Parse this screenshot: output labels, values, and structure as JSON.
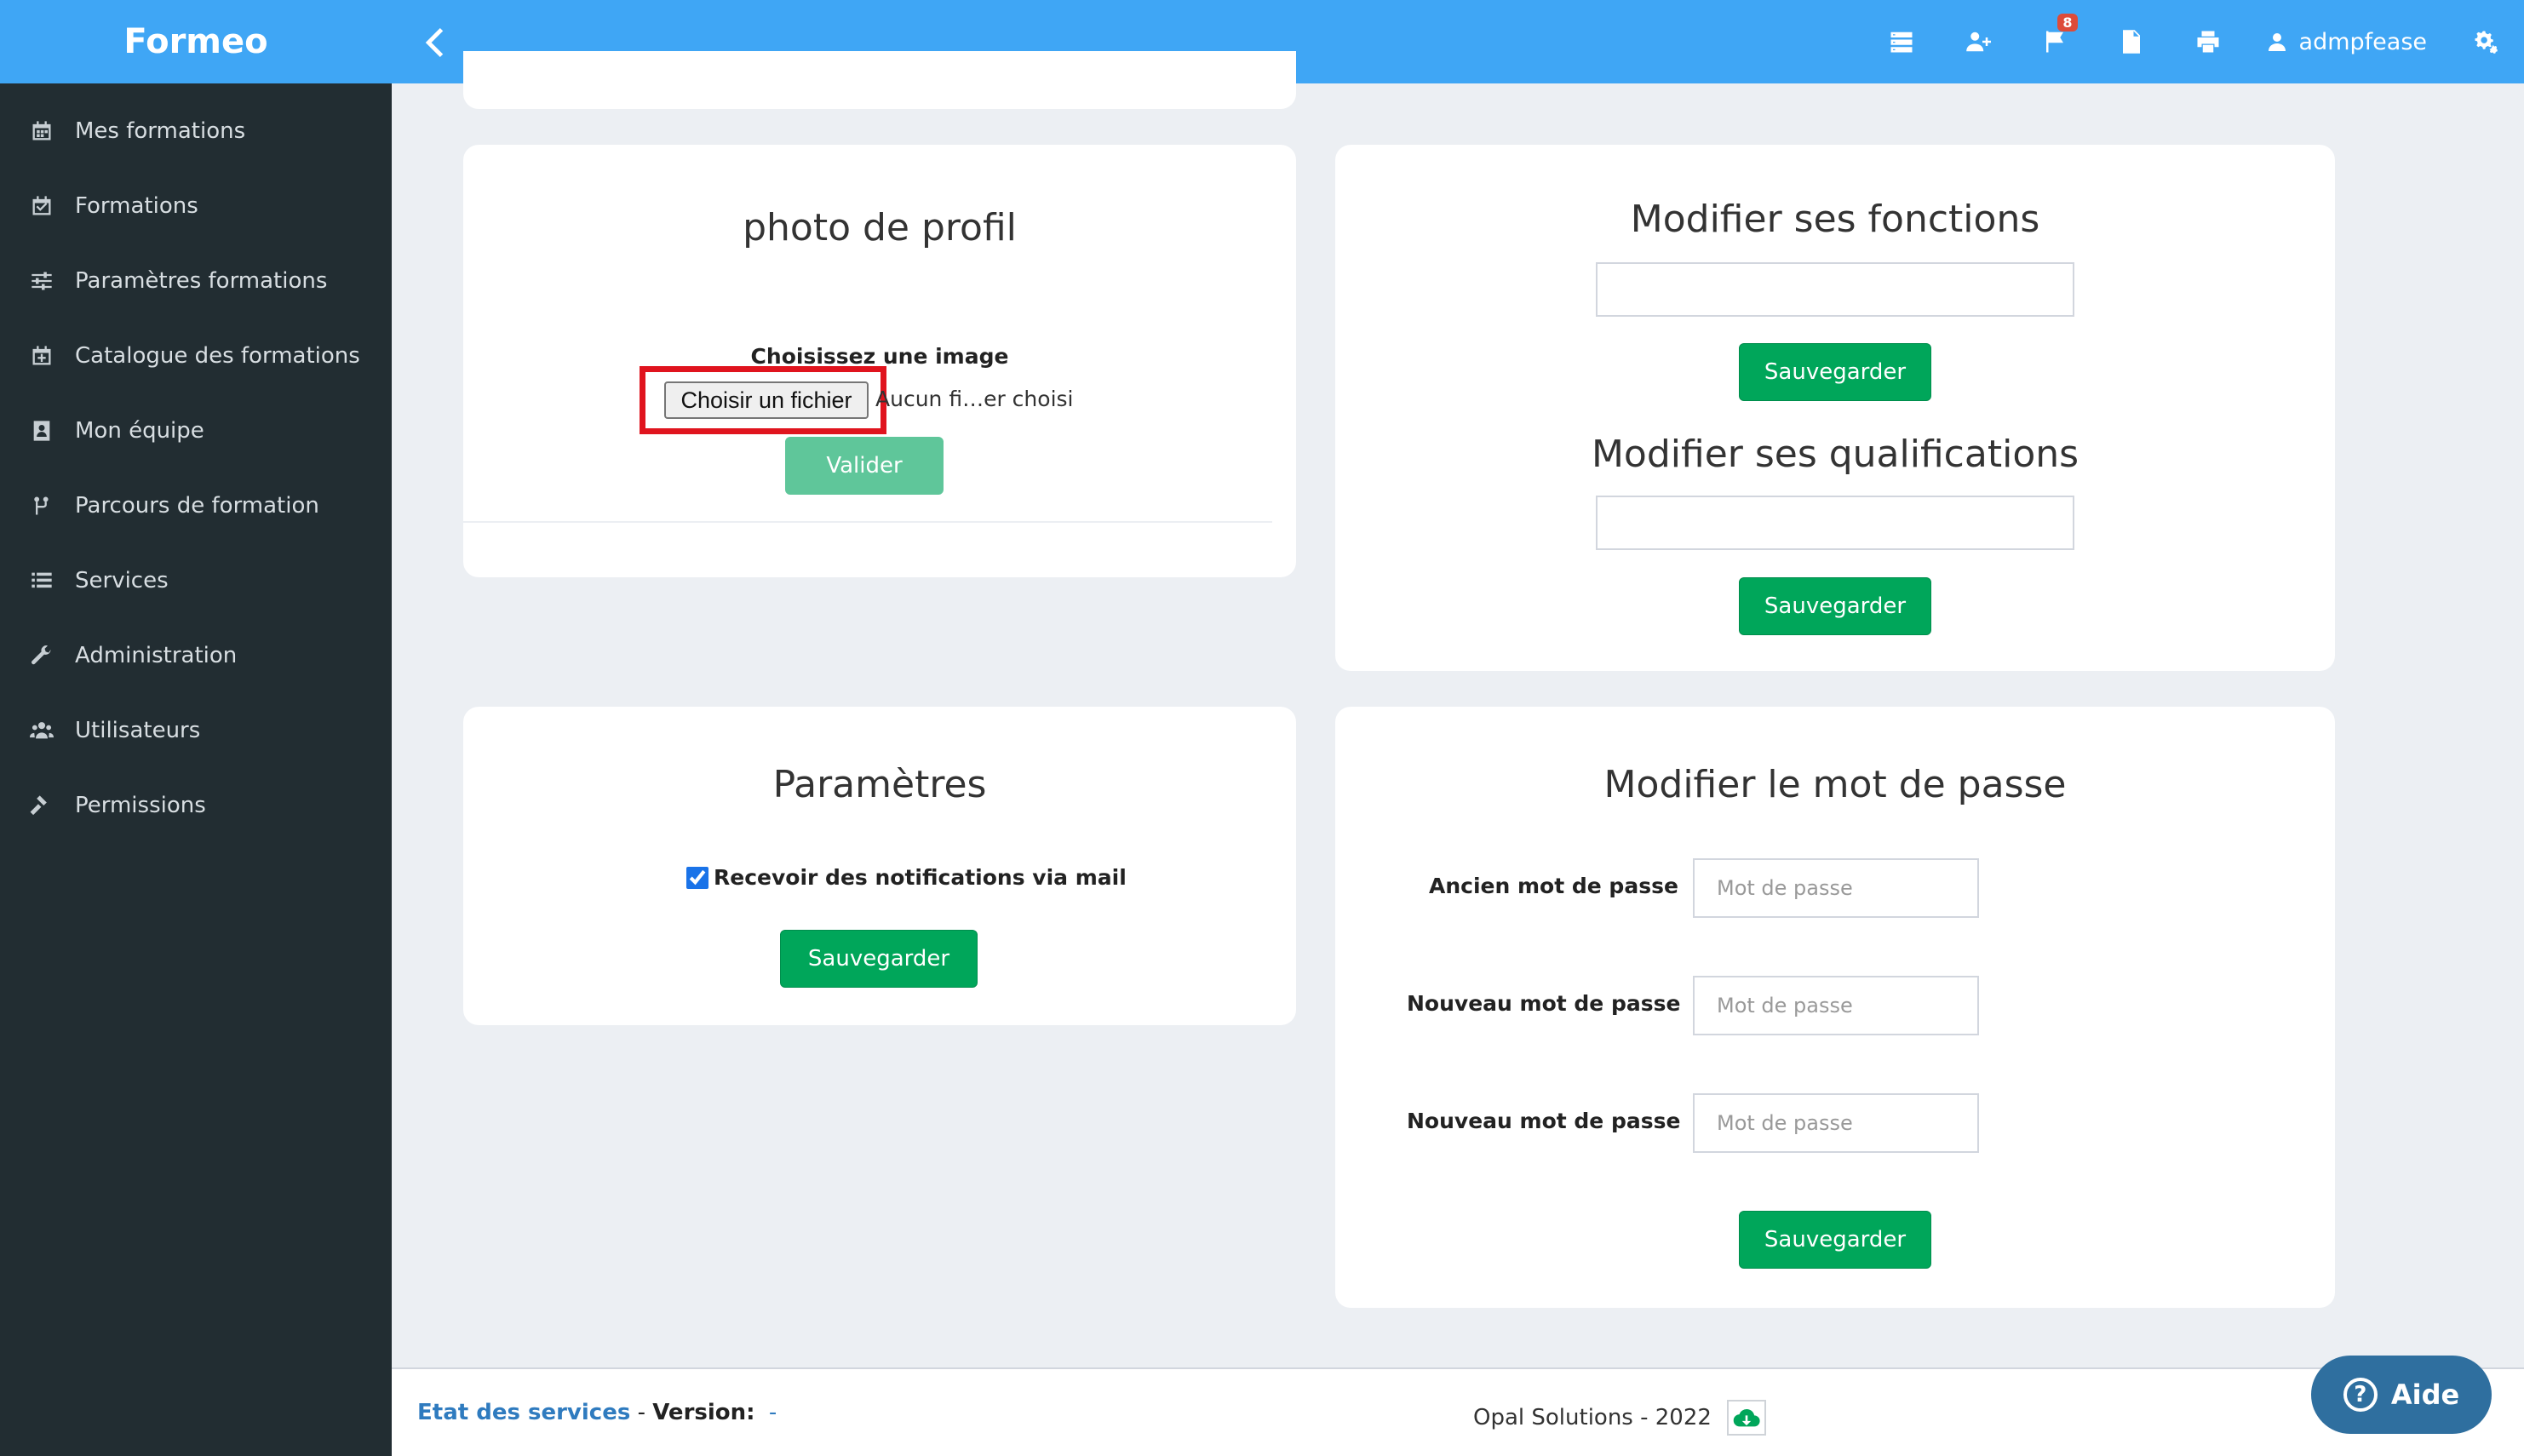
{
  "brand": "Formeo",
  "sidebar": {
    "items": [
      {
        "label": "Mes formations",
        "icon": "calendar-icon"
      },
      {
        "label": "Formations",
        "icon": "calendar-check-icon"
      },
      {
        "label": "Paramètres formations",
        "icon": "sliders-icon"
      },
      {
        "label": "Catalogue des formations",
        "icon": "calendar-plus-icon"
      },
      {
        "label": "Mon équipe",
        "icon": "address-book-icon"
      },
      {
        "label": "Parcours de formation",
        "icon": "code-fork-icon"
      },
      {
        "label": "Services",
        "icon": "list-icon"
      },
      {
        "label": "Administration",
        "icon": "wrench-icon"
      },
      {
        "label": "Utilisateurs",
        "icon": "users-icon"
      },
      {
        "label": "Permissions",
        "icon": "gavel-icon"
      }
    ]
  },
  "header": {
    "notification_count": "8",
    "username": "admpfease"
  },
  "photo_card": {
    "title": "photo de profil",
    "choose_label": "Choisissez une image",
    "file_button": "Choisir un fichier",
    "file_status": "Aucun fi…er choisi",
    "submit": "Valider"
  },
  "functions_card": {
    "title_functions": "Modifier ses fonctions",
    "save_functions": "Sauvegarder",
    "title_qualifications": "Modifier ses qualifications",
    "save_qualifications": "Sauvegarder"
  },
  "settings_card": {
    "title": "Paramètres",
    "checkbox_label": "Recevoir des notifications via mail",
    "checkbox_checked": true,
    "save": "Sauvegarder"
  },
  "password_card": {
    "title": "Modifier le mot de passe",
    "old_label": "Ancien mot de passe",
    "new_label": "Nouveau mot de passe",
    "confirm_label": "Nouveau mot de passe",
    "placeholder": "Mot de passe",
    "save": "Sauvegarder"
  },
  "footer": {
    "status_link": "Etat des services",
    "version_label": "Version:",
    "version_value": "-",
    "copyright": "Opal Solutions - 2022"
  },
  "help_button": "Aide",
  "colors": {
    "topbar": "#3fa6f5",
    "sidebar": "#222d32",
    "success": "#00a65a",
    "highlight": "#e0141e"
  }
}
